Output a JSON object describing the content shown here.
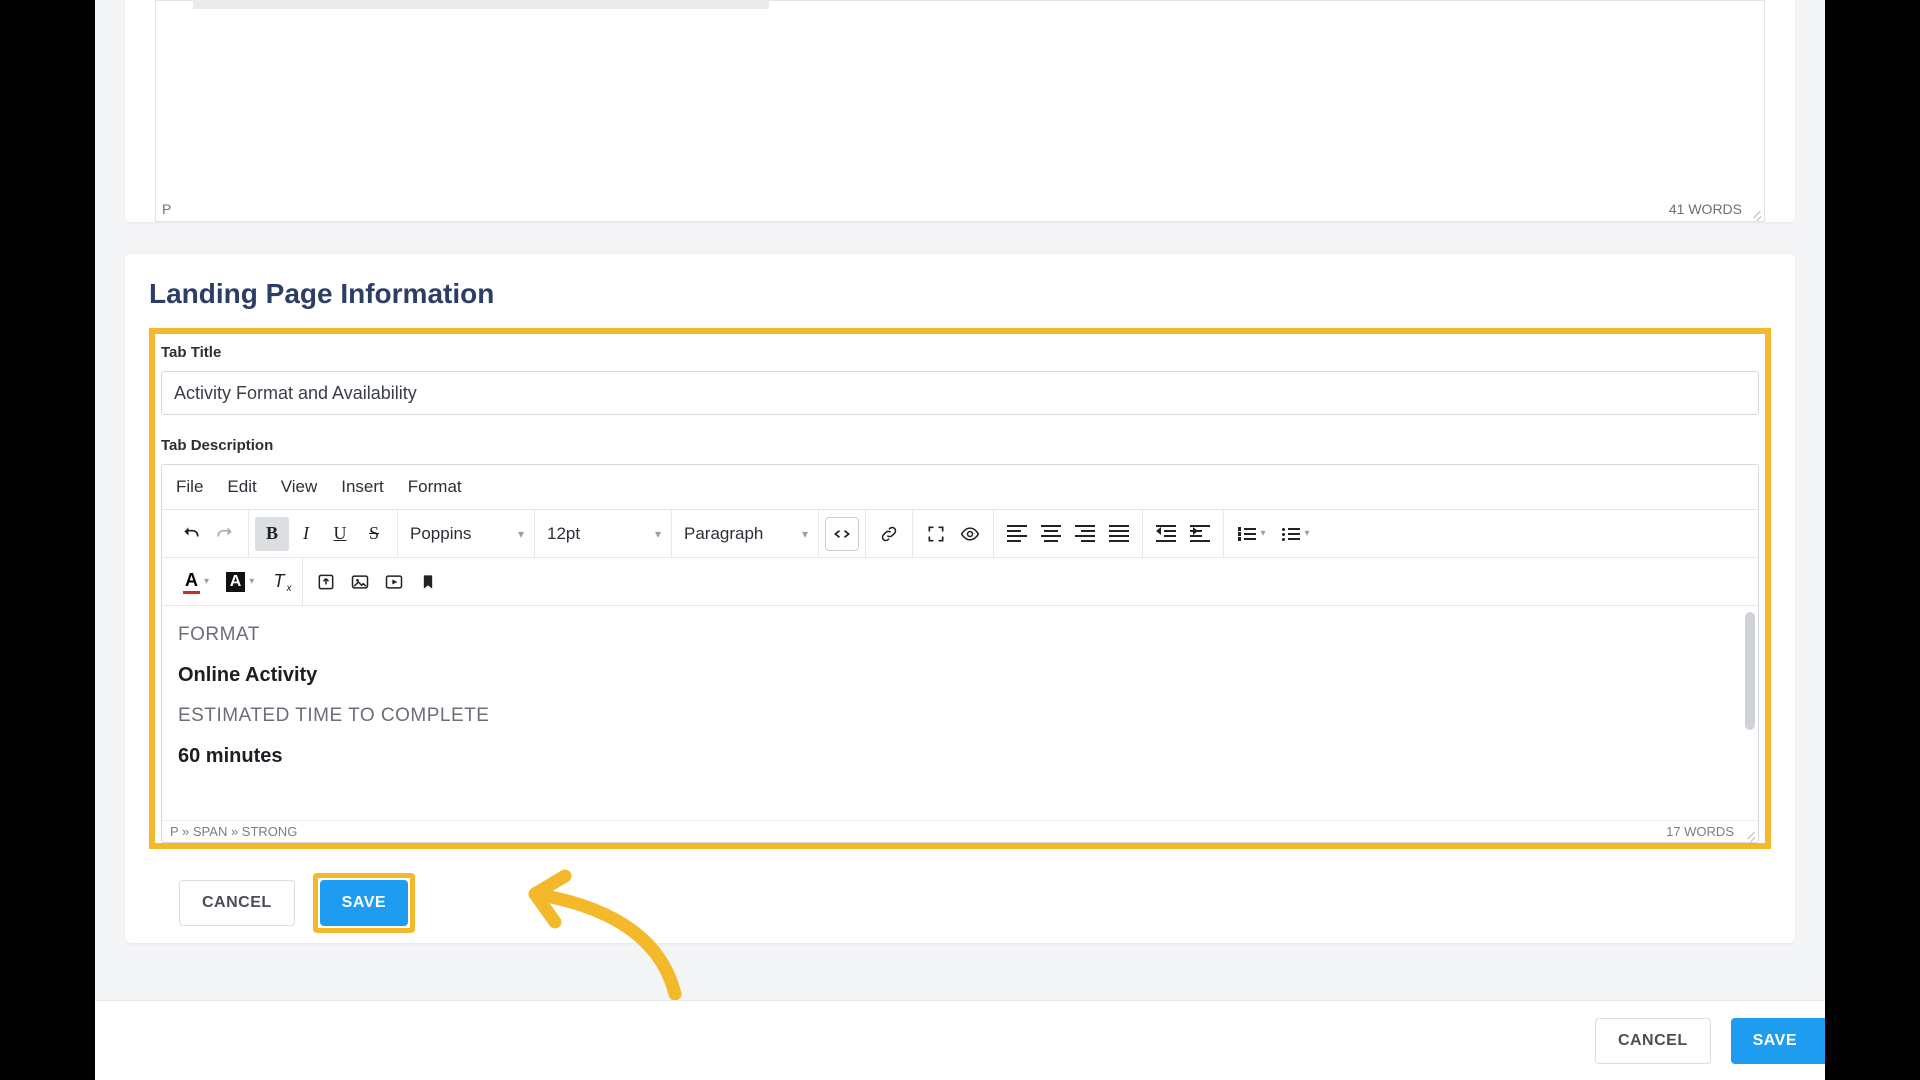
{
  "topEditor": {
    "path": "P",
    "words": "41 WORDS"
  },
  "section": {
    "heading": "Landing Page Information"
  },
  "tabTitle": {
    "label": "Tab Title",
    "value": "Activity Format and Availability"
  },
  "tabDesc": {
    "label": "Tab Description"
  },
  "menu": {
    "file": "File",
    "edit": "Edit",
    "view": "View",
    "insert": "Insert",
    "format": "Format"
  },
  "toolbar": {
    "font": "Poppins",
    "size": "12pt",
    "block": "Paragraph"
  },
  "content": {
    "h1": "FORMAT",
    "l1": "Online Activity",
    "h2": "ESTIMATED TIME TO COMPLETE",
    "l2": "60 minutes"
  },
  "status": {
    "path": "P » SPAN » STRONG",
    "words": "17 WORDS"
  },
  "buttons": {
    "cancel": "CANCEL",
    "save": "SAVE"
  },
  "footer": {
    "cancel": "CANCEL",
    "save": "SAVE"
  },
  "annotation": {
    "color": "#f4b92a"
  }
}
